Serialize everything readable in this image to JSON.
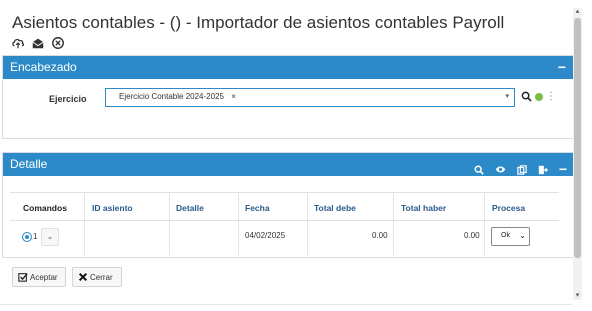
{
  "window": {
    "title": "Asientos contables - () - Importador de asientos contables Payroll",
    "title_icons": [
      "cloud-upload-icon",
      "envelope-open-icon",
      "close-circle-icon"
    ]
  },
  "encabezado": {
    "header": "Encabezado",
    "collapse_symbol": "−",
    "ejercicio": {
      "label": "Ejercicio",
      "value": "Ejercicio Contable 2024-2025",
      "clear_symbol": "×",
      "caret": "▾"
    },
    "tools": [
      "search-icon",
      "status-dot-icon",
      "kebab-menu-icon"
    ],
    "status_color": "#7cbc48"
  },
  "detalle": {
    "header": "Detalle",
    "collapse_symbol": "−",
    "tools": [
      "search-icon",
      "eye-icon",
      "copy-icon",
      "export-icon"
    ],
    "columns": [
      "Comandos",
      "ID asiento",
      "Detalle",
      "Fecha",
      "Total debe",
      "Total haber",
      "Procesa"
    ],
    "rows": [
      {
        "num": "1",
        "menu": "⌄",
        "id_asiento": "",
        "detalle": "",
        "fecha": "04/02/2025",
        "total_debe": "0.00",
        "total_haber": "0.00",
        "procesa": "Ok",
        "procesa_caret": "⌄"
      }
    ]
  },
  "buttons": {
    "aceptar": "Aceptar",
    "cerrar": "Cerrar"
  },
  "colors": {
    "header_blue": "#2d8ac9",
    "column_header_text": "#2a5a8a"
  }
}
